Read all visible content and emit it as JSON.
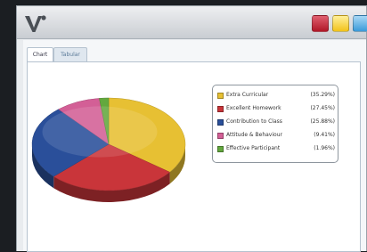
{
  "window": {
    "tabs": [
      {
        "label": "Chart",
        "active": true
      },
      {
        "label": "Tabular",
        "active": false
      }
    ]
  },
  "colors": {
    "extra_curricular": "#e7c033",
    "excellent_homework": "#c9353a",
    "contribution_to_class": "#2a4f9a",
    "attitude_behaviour": "#d35f96",
    "effective_participant": "#63a83e"
  },
  "chart_data": {
    "type": "pie",
    "style": "3d",
    "title": "",
    "legend_placement": "right",
    "slices": [
      {
        "label": "Extra Curricular",
        "value": 35.29,
        "value_label": "(35.29%)",
        "color": "#e7c033"
      },
      {
        "label": "Excellent Homework",
        "value": 27.45,
        "value_label": "(27.45%)",
        "color": "#c9353a"
      },
      {
        "label": "Contribution to Class",
        "value": 25.88,
        "value_label": "(25.88%)",
        "color": "#2a4f9a"
      },
      {
        "label": "Attitude & Behaviour",
        "value": 9.41,
        "value_label": "(9.41%)",
        "color": "#d35f96"
      },
      {
        "label": "Effective Participant",
        "value": 1.96,
        "value_label": "(1.96%)",
        "color": "#63a83e"
      }
    ]
  }
}
